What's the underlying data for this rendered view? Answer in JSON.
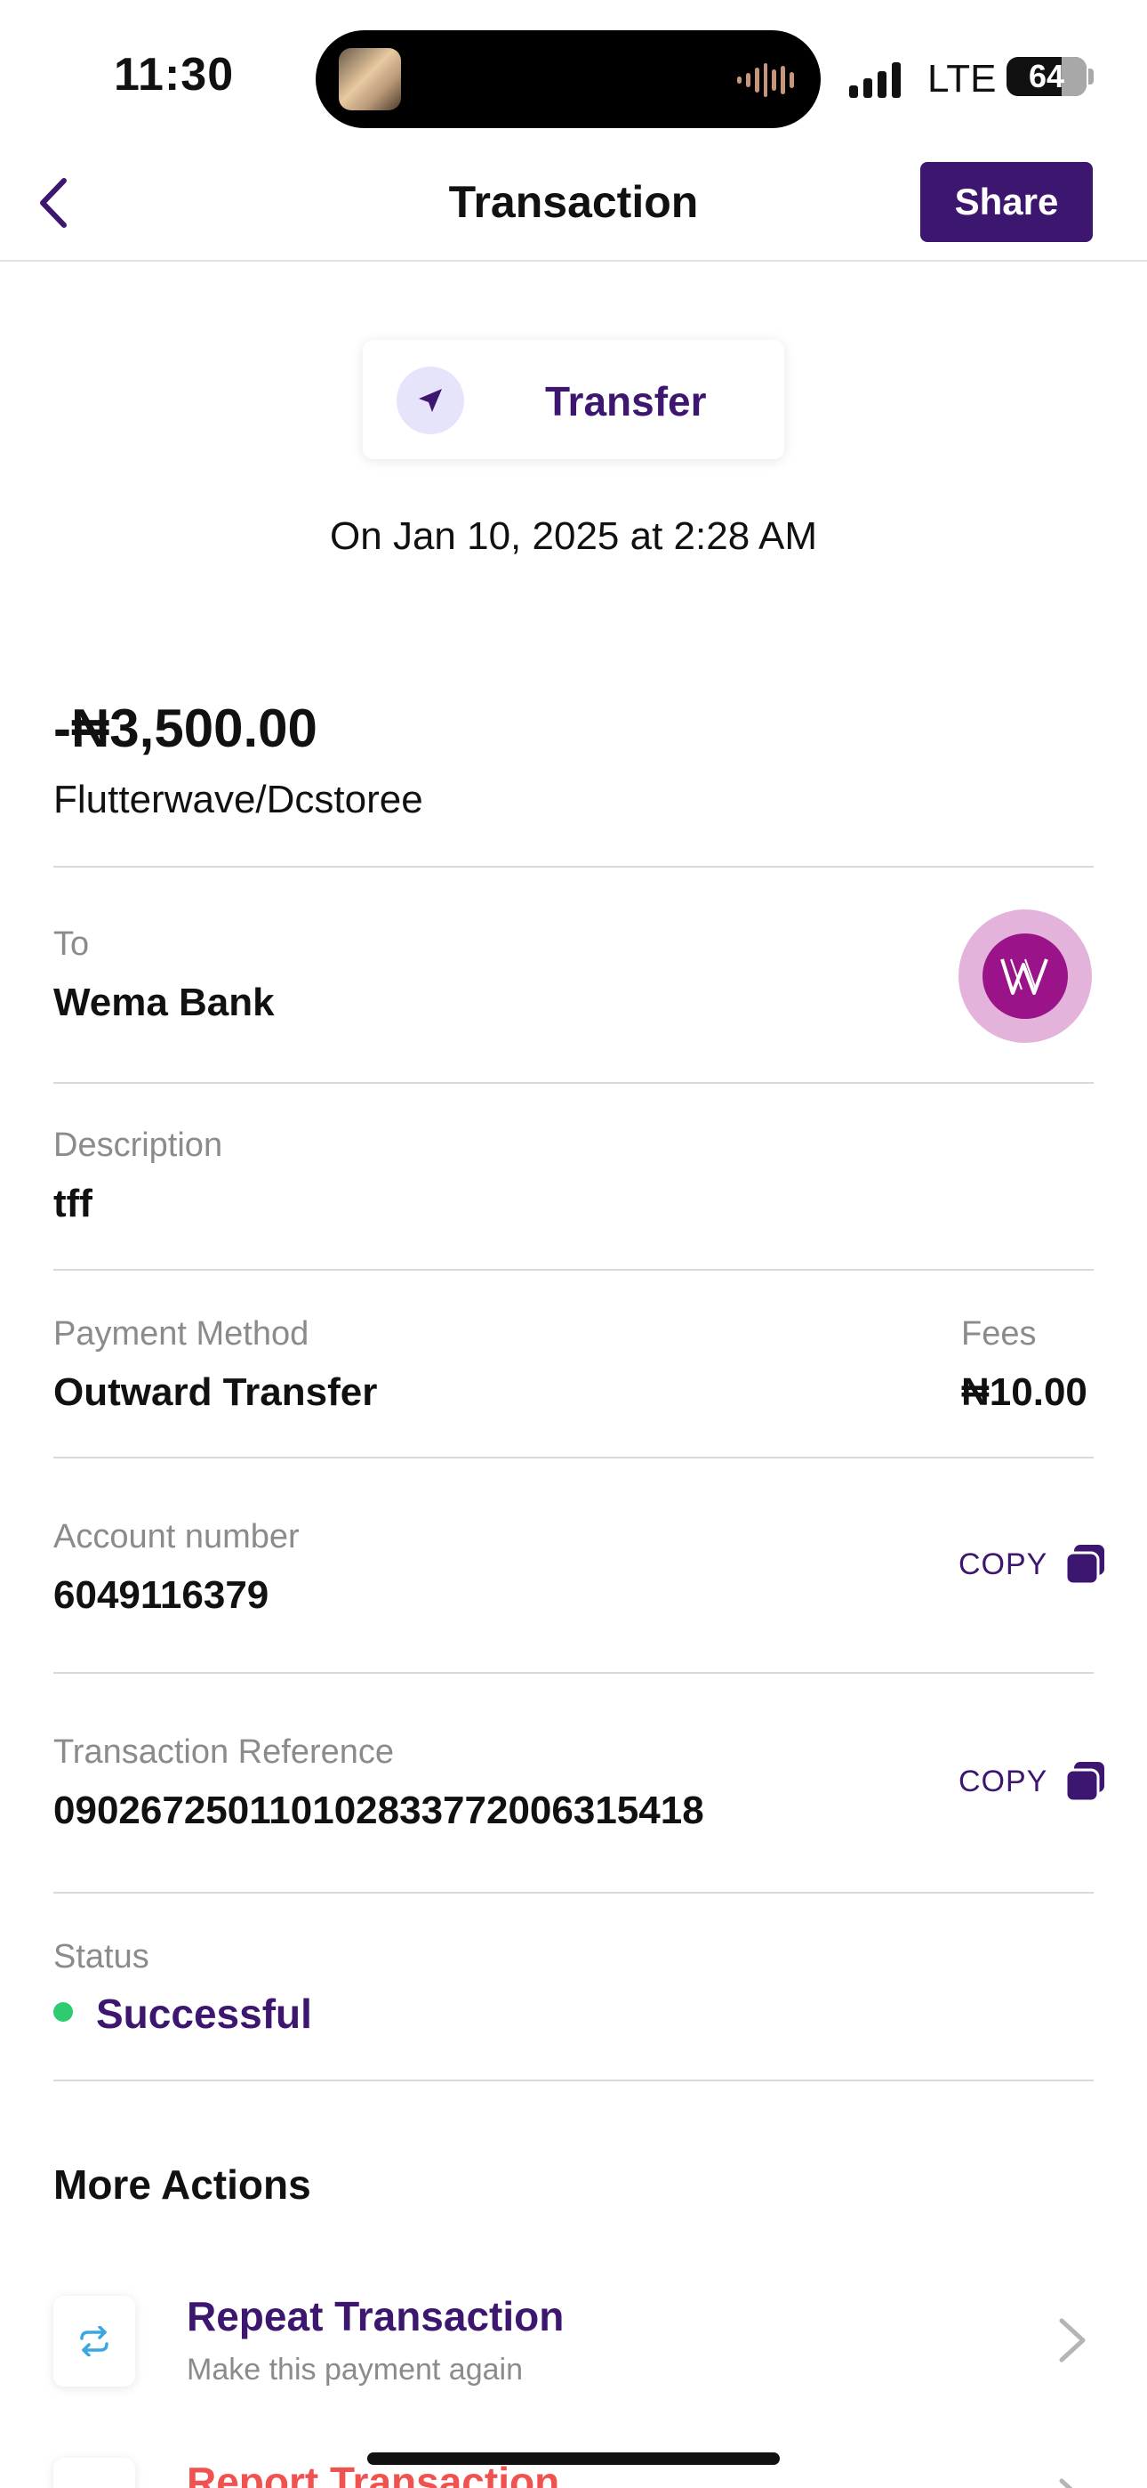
{
  "status_bar": {
    "time": "11:30",
    "network": "LTE",
    "battery": "64"
  },
  "nav": {
    "title": "Transaction",
    "share_label": "Share",
    "back_icon": "chevron-left-icon"
  },
  "transaction": {
    "type": "Transfer",
    "type_icon": "send-arrow-icon",
    "date_line": "On Jan 10, 2025 at 2:28 AM",
    "amount": "-₦3,500.00",
    "merchant": "Flutterwave/Dcstoree"
  },
  "details": {
    "to_label": "To",
    "to_value": "Wema Bank",
    "description_label": "Description",
    "description_value": "tff",
    "payment_method_label": "Payment Method",
    "payment_method_value": "Outward Transfer",
    "fees_label": "Fees",
    "fees_value": "₦10.00",
    "account_number_label": "Account number",
    "account_number_value": "6049116379",
    "reference_label": "Transaction Reference",
    "reference_value": "090267250110102833772006315418",
    "copy_label": "COPY",
    "status_label": "Status",
    "status_value": "Successful"
  },
  "more_actions": {
    "title": "More Actions",
    "items": [
      {
        "title": "Repeat Transaction",
        "subtitle": "Make this payment again",
        "icon": "repeat-icon"
      },
      {
        "title": "Report Transaction",
        "icon": "report-icon"
      }
    ]
  },
  "colors": {
    "brand_purple": "#3d1670",
    "success_green": "#2ecc71",
    "report_red": "#f0524f",
    "wema_magenta": "#9b1388"
  }
}
